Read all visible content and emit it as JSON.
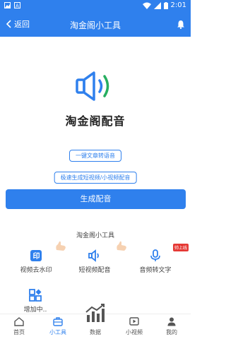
{
  "status_bar": {
    "time": "2:01",
    "left_icons": [
      "image-icon",
      "a-icon"
    ],
    "right_icons": [
      "wifi-icon",
      "signal-icon",
      "battery-icon"
    ]
  },
  "app_bar": {
    "back_label": "返回",
    "title": "淘金阁小工具"
  },
  "hero": {
    "app_name": "淘金阁配音",
    "tag1": "一键文章转语音",
    "tag2": "极速生成短视频/小视频配音"
  },
  "primary_button": "生成配音",
  "tools_section": {
    "title": "淘金阁小工具",
    "items": [
      {
        "label": "视频去水印",
        "icon": "watermark-icon"
      },
      {
        "label": "短视频配音",
        "icon": "speaker-icon"
      },
      {
        "label": "音频转文字",
        "icon": "microphone-icon",
        "badge": "帅上线"
      },
      {
        "label": "增加中..",
        "icon": "grid-icon"
      }
    ]
  },
  "tabs": [
    {
      "label": "首页",
      "icon": "home-icon"
    },
    {
      "label": "小工具",
      "icon": "toolbox-icon",
      "active": true
    },
    {
      "label": "数据",
      "icon": "chart-icon"
    },
    {
      "label": "小视频",
      "icon": "video-icon"
    },
    {
      "label": "我的",
      "icon": "person-icon"
    }
  ],
  "colors": {
    "primary": "#2f80ed",
    "badge": "#e53935",
    "hand": "#f5c9a3"
  }
}
